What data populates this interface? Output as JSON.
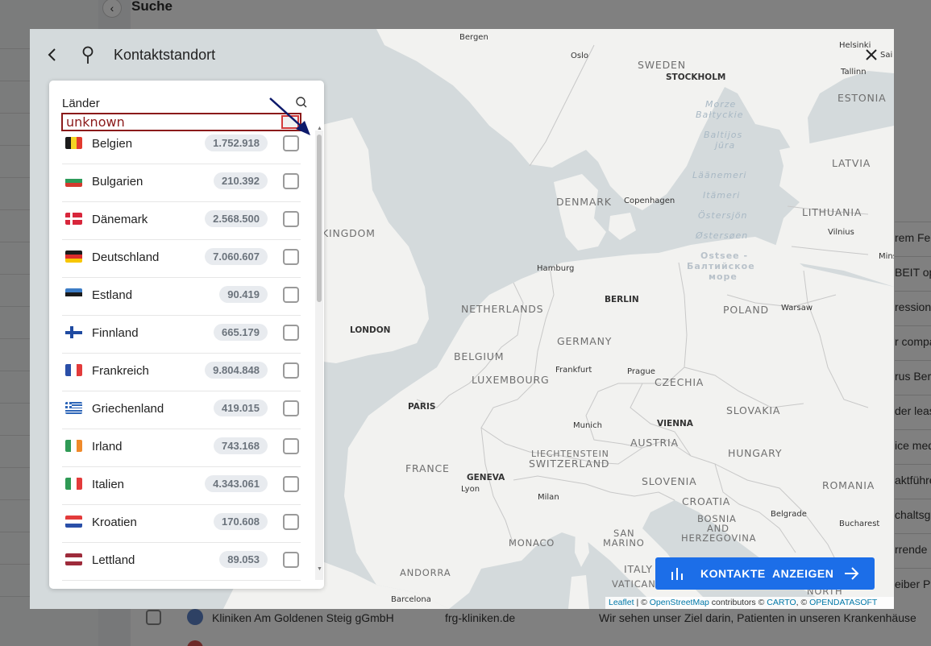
{
  "background": {
    "title": "Suche",
    "collapse_icon": "chevron-left-icon",
    "right_snippets": [
      "rem Fer",
      "BEIT operi",
      "ressione",
      "r compa",
      "rus Berl",
      "der leas",
      "ice med",
      "aktführe",
      "chaltsge",
      "rrende",
      "eiber Pie"
    ],
    "bottom_row": {
      "company": "Kliniken Am Goldenen Steig gGmbH",
      "domain": "frg-kliniken.de",
      "description": "Wir sehen unser Ziel darin, Patienten in unseren Krankenhäuse"
    }
  },
  "modal": {
    "title": "Kontaktstandort",
    "back_icon": "chevron-left-icon",
    "location_icon": "map-pin-icon",
    "close_icon": "close-icon"
  },
  "panel": {
    "title": "Länder",
    "search_icon": "search-icon",
    "annotation_label": "unknown",
    "countries": [
      {
        "name": "Belgien",
        "count": "1.752.918",
        "flag": "be"
      },
      {
        "name": "Bulgarien",
        "count": "210.392",
        "flag": "bg"
      },
      {
        "name": "Dänemark",
        "count": "2.568.500",
        "flag": "dk"
      },
      {
        "name": "Deutschland",
        "count": "7.060.607",
        "flag": "de"
      },
      {
        "name": "Estland",
        "count": "90.419",
        "flag": "ee"
      },
      {
        "name": "Finnland",
        "count": "665.179",
        "flag": "fi"
      },
      {
        "name": "Frankreich",
        "count": "9.804.848",
        "flag": "fr"
      },
      {
        "name": "Griechenland",
        "count": "419.015",
        "flag": "gr"
      },
      {
        "name": "Irland",
        "count": "743.168",
        "flag": "ie"
      },
      {
        "name": "Italien",
        "count": "4.343.061",
        "flag": "it"
      },
      {
        "name": "Kroatien",
        "count": "170.608",
        "flag": "hr"
      },
      {
        "name": "Lettland",
        "count": "89.053",
        "flag": "lv"
      }
    ]
  },
  "map": {
    "countries": [
      "SWEDEN",
      "ESTONIA",
      "LATVIA",
      "DENMARK",
      "LITHUANIA",
      "KINGDOM",
      "NETHERLANDS",
      "POLAND",
      "GERMANY",
      "BELGIUM",
      "LUXEMBOURG",
      "CZECHIA",
      "SLOVAKIA",
      "AUSTRIA",
      "FRANCE",
      "LIECHTENSTEIN",
      "SWITZERLAND",
      "HUNGARY",
      "SLOVENIA",
      "ROMANIA",
      "CROATIA",
      "BOSNIA",
      "AND",
      "HERZEGOVINA",
      "SAN",
      "MARINO",
      "MONACO",
      "ANDORRA",
      "ITALY",
      "VATICAN",
      "NORTH"
    ],
    "cities": [
      "Bergen",
      "Oslo",
      "Helsinki",
      "Tallinn",
      "STOCKHOLM",
      "Copenhagen",
      "Vilnius",
      "Hamburg",
      "BERLIN",
      "Warsaw",
      "LONDON",
      "Frankfurt",
      "Prague",
      "PARIS",
      "Munich",
      "VIENNA",
      "GENEVA",
      "Lyon",
      "Milan",
      "Belgrade",
      "Bucharest",
      "Barcelona",
      "Mins"
    ],
    "seas": [
      "Morze",
      "Bałtyckie",
      "Baltijos",
      "jūra",
      "Läänemeri",
      "Itämeri",
      "Östersjön",
      "Østersøen",
      "Ostsee -",
      "Балтийское",
      "море"
    ],
    "partial": [
      "Sai"
    ]
  },
  "cta": {
    "label": "KONTAKTE  ANZEIGEN",
    "icon": "bar-chart-icon",
    "arrow_icon": "arrow-right-icon"
  },
  "attribution": {
    "leaflet": "Leaflet",
    "sep1": " | © ",
    "osm": "OpenStreetMap",
    "contrib": " contributors © ",
    "carto": "CARTO",
    "sep2": ", © ",
    "ods": "OPENDATASOFT"
  },
  "annotation": {
    "arrow_color": "#0d1a6b",
    "box_color": "#8b1a1a"
  },
  "colors": {
    "accent": "#1c6ee8",
    "water": "#d4dadc",
    "land": "#f2f2f0",
    "overlay": "#7d7f82"
  }
}
